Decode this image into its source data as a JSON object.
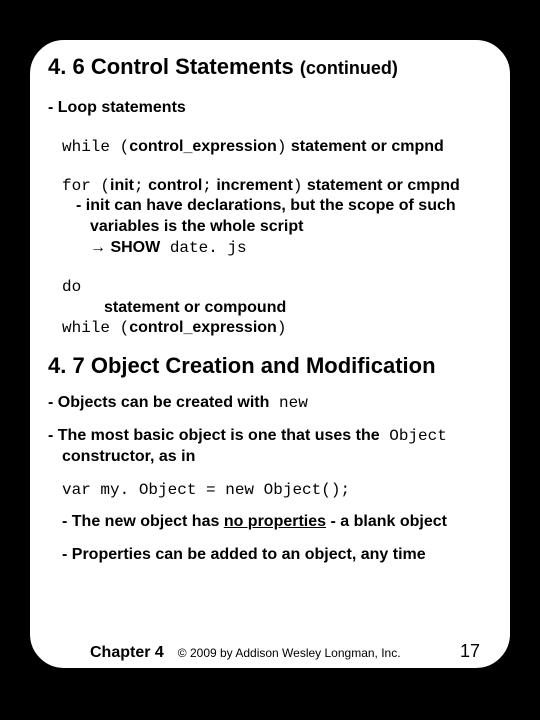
{
  "heading1": {
    "num": "4. 6",
    "title": "Control Statements",
    "cont": "(continued)"
  },
  "loop_label": "- Loop statements",
  "while": {
    "kw": "while (",
    "expr": "control_expression",
    "close": ")",
    "rest": " statement or cmpnd"
  },
  "for": {
    "kw": "for (",
    "init": "init",
    "sep1": ";",
    "control": " control",
    "sep2": ";",
    "inc": " increment",
    "close": ")",
    "rest": " statement or cmpnd"
  },
  "for_note1a": "- init can have declarations, but the scope of such",
  "for_note1b": "variables is the whole script",
  "arrow": "→",
  "show": " SHOW",
  "datejs": " date. js",
  "do": {
    "kw_do": "do",
    "body": "statement or compound",
    "kw_while": "while (",
    "expr": "control_expression",
    "close": ")"
  },
  "heading2": {
    "num": "4. 7",
    "title": "Object Creation and Modification"
  },
  "obj_line1a": "- Objects can be created with",
  "obj_new": " new",
  "obj_line2a": "- The most basic object is one that uses the",
  "obj_Object": " Object",
  "obj_line2b": "constructor, as in",
  "obj_code": "var my. Object = new Object();",
  "obj_line3a": "- The new object has ",
  "obj_line3u": "no properties",
  "obj_line3b": " - a blank object",
  "obj_line4": "- Properties can be added to an object, any time",
  "footer": {
    "chapter": "Chapter 4",
    "copyright": "© 2009 by Addison Wesley Longman, Inc.",
    "page": "17"
  }
}
